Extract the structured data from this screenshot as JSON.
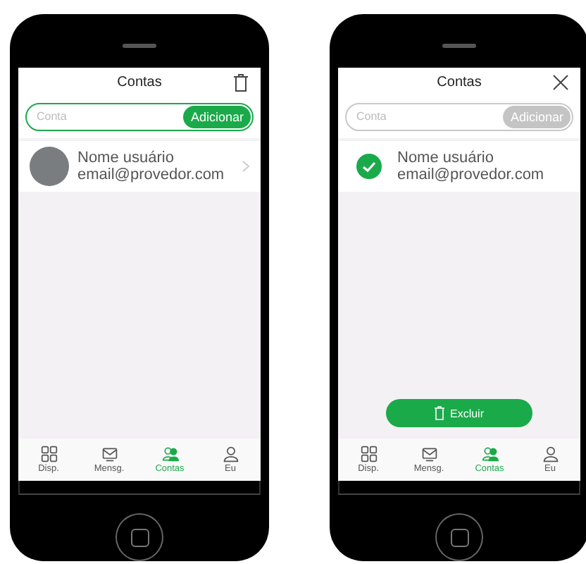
{
  "phones": [
    {
      "kind": "view",
      "title": "Contas",
      "search": {
        "placeholder": "Conta",
        "button": "Adicionar"
      },
      "accounts": [
        {
          "name": "Nome usuário",
          "email": "email@provedor.com"
        }
      ],
      "tabs": [
        {
          "label": "Disp.",
          "selected": false
        },
        {
          "label": "Mensg.",
          "selected": false
        },
        {
          "label": "Contas",
          "selected": true
        },
        {
          "label": "Eu",
          "selected": false
        }
      ]
    },
    {
      "kind": "edit",
      "title": "Contas",
      "search": {
        "placeholder": "Conta",
        "button": "Adicionar"
      },
      "accounts": [
        {
          "name": "Nome usuário",
          "email": "email@provedor.com",
          "selected": true
        }
      ],
      "delete_button": {
        "label": "Excluir"
      },
      "tabs": [
        {
          "label": "Disp.",
          "selected": false
        },
        {
          "label": "Mensg.",
          "selected": false
        },
        {
          "label": "Contas",
          "selected": true
        },
        {
          "label": "Eu",
          "selected": false
        }
      ]
    }
  ]
}
